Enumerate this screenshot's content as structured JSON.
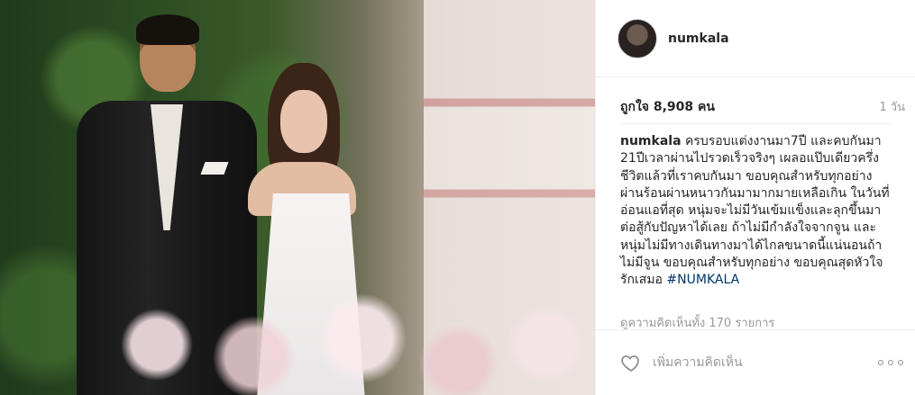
{
  "post": {
    "username": "numkala",
    "likes": "ถูกใจ 8,908 คน",
    "time_ago": "1 วัน",
    "caption_user": "numkala",
    "caption_text": " ครบรอบแต่งงานมา7ปี และคบกันมา 21ปีเวลาผ่านไปรวดเร็วจริงๆ เผลอแป๊บเดียวครึ่งชีวิตแล้วที่เราคบกันมา ขอบคุณสำหรับทุกอย่าง ผ่านร้อนผ่านหนาวกันมามากมายเหลือเกิน ในวันที่อ่อนแอที่สุด หนุ่มจะไม่มีวันเข้มแข็งและลุกขึ้นมาต่อสู้กับปัญหาได้เลย ถ้าไม่มีกำลังใจจากจูน และหนุ่มไม่มีทางเดินทางมาได้ไกลขนาดนี้แน่นอนถ้าไม่มีจูน ขอบคุณสำหรับทุกอย่าง ขอบคุณสุดหัวใจ รักเสมอ ",
    "hashtag": "#NUMKALA",
    "view_comments": "ดูความคิดเห็นทั้ง 170 รายการ",
    "add_comment_placeholder": "เพิ่มความคิดเห็น"
  },
  "icons": {
    "heart": "heart-icon",
    "more": "more-options-icon"
  }
}
